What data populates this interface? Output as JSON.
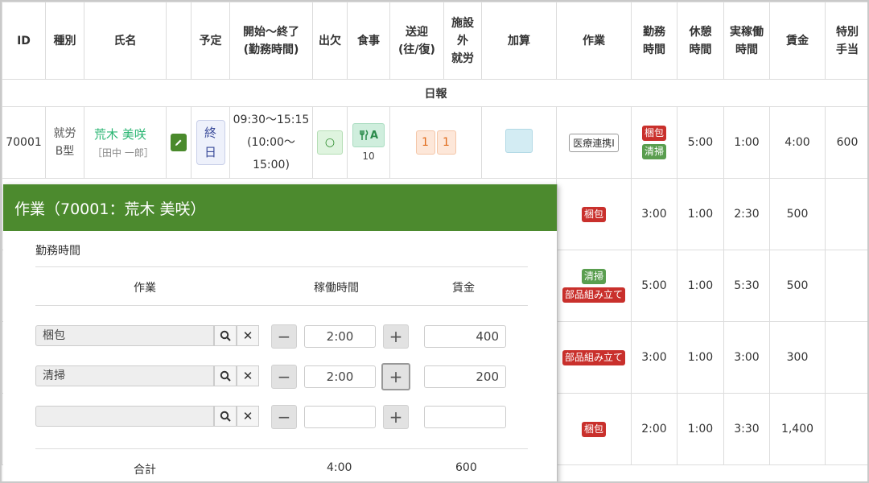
{
  "columns": [
    "ID",
    "種別",
    "氏名",
    "",
    "予定",
    "開始〜終了",
    "(勤務時間)",
    "出欠",
    "食事",
    "送迎",
    "(往/復)",
    "施設",
    "外",
    "就労",
    "加算",
    "作業",
    "勤務",
    "時間",
    "休憩",
    "時間",
    "実稼働",
    "時間",
    "賃金",
    "特別",
    "手当"
  ],
  "section_title": "日報",
  "row1": {
    "id": "70001",
    "kind_line1": "就労",
    "kind_line2": "B型",
    "name": "荒木 美咲",
    "sub_name": "［田中 一郎］",
    "plan_line1": "終",
    "plan_line2": "日",
    "time_range": "09:30〜15:15",
    "work_range": "(10:00〜15:00)",
    "attendance": "○",
    "meal": "A",
    "meal_count": "10",
    "transfer_go": "1",
    "transfer_back": "1",
    "addition": "医療連携Ⅰ",
    "tags": [
      "梱包",
      "清掃"
    ],
    "work_hours": "5:00",
    "break_hours": "1:00",
    "actual_hours": "4:00",
    "wage": "600"
  },
  "rows": [
    {
      "tags": [
        "梱包"
      ],
      "work_hours": "3:00",
      "break_hours": "1:00",
      "actual_hours": "2:30",
      "wage": "500"
    },
    {
      "tags": [
        "清掃",
        "部品組み立て"
      ],
      "work_hours": "5:00",
      "break_hours": "1:00",
      "actual_hours": "5:30",
      "wage": "500"
    },
    {
      "tags": [
        "部品組み立て"
      ],
      "work_hours": "3:00",
      "break_hours": "1:00",
      "actual_hours": "3:00",
      "wage": "300"
    },
    {
      "tags": [
        "梱包"
      ],
      "work_hours": "2:00",
      "break_hours": "1:00",
      "actual_hours": "3:30",
      "wage": "1,400"
    }
  ],
  "modal": {
    "title": "作業（70001：荒木 美咲）",
    "section_label": "勤務時間",
    "col_task": "作業",
    "col_hours": "稼働時間",
    "col_wage": "賃金",
    "entries": [
      {
        "task": "梱包",
        "hours": "2:00",
        "wage": "400"
      },
      {
        "task": "清掃",
        "hours": "2:00",
        "wage": "200"
      },
      {
        "task": "",
        "hours": "",
        "wage": ""
      }
    ],
    "total_label": "合計",
    "total_hours": "4:00",
    "total_wage": "600"
  },
  "icons": {
    "edit": "pencil-icon",
    "search": "search-icon",
    "clear": "close-icon",
    "meal": "fork-knife-icon",
    "minus": "minus-icon",
    "plus": "plus-icon"
  },
  "colors": {
    "header_green": "#4c8a2e",
    "accent_green": "#2bb673",
    "tag_red": "#c9302c",
    "tag_green": "#5a9e4f"
  }
}
